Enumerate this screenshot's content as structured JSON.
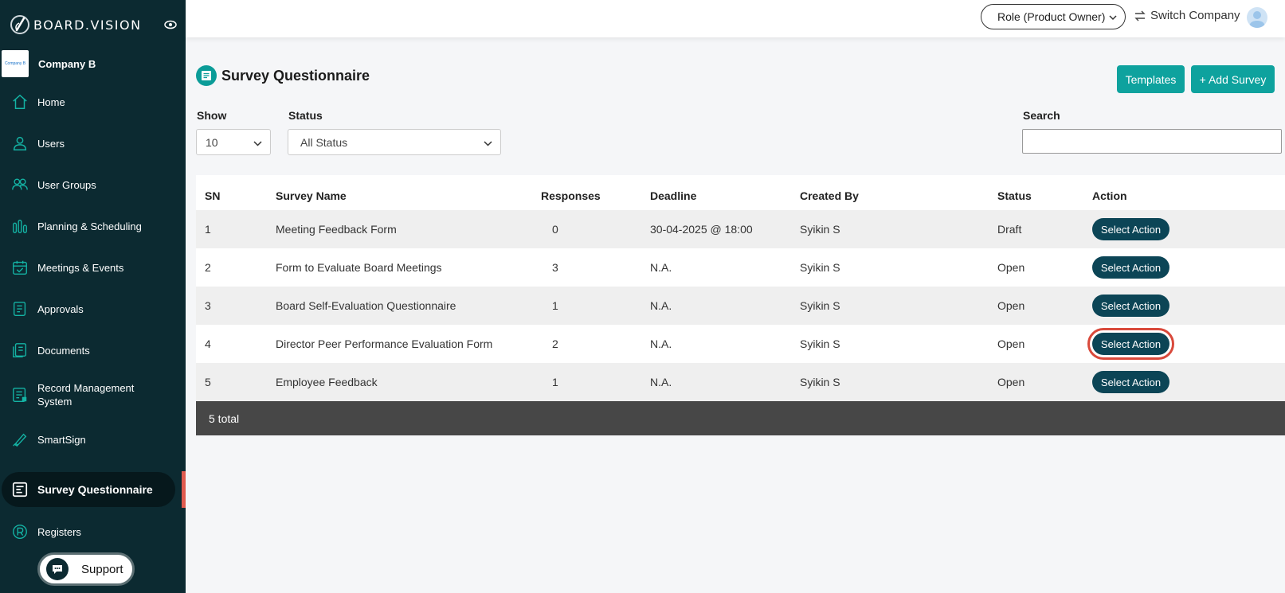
{
  "brand": {
    "name": "BOARD.VISION"
  },
  "company": {
    "name": "Company B",
    "logo_text": "Company B"
  },
  "sidebar": {
    "items": [
      {
        "label": "Home",
        "icon": "home-icon"
      },
      {
        "label": "Users",
        "icon": "user-icon"
      },
      {
        "label": "User Groups",
        "icon": "users-icon"
      },
      {
        "label": "Planning & Scheduling",
        "icon": "bar-chart-icon"
      },
      {
        "label": "Meetings & Events",
        "icon": "calendar-icon"
      },
      {
        "label": "Approvals",
        "icon": "approval-icon"
      },
      {
        "label": "Documents",
        "icon": "documents-icon"
      },
      {
        "label": "Record Management System",
        "icon": "record-icon"
      },
      {
        "label": "SmartSign",
        "icon": "pen-icon"
      },
      {
        "label": "Survey Questionnaire",
        "icon": "survey-icon",
        "active": true
      },
      {
        "label": "Registers",
        "icon": "registered-icon"
      }
    ],
    "support_label": "Support"
  },
  "topbar": {
    "role_label": "Role (Product Owner)",
    "switch_company_label": "Switch Company"
  },
  "page": {
    "title": "Survey Questionnaire",
    "templates_label": "Templates",
    "add_survey_label": "+ Add Survey"
  },
  "filters": {
    "show_label": "Show",
    "show_value": "10",
    "status_label": "Status",
    "status_value": "All Status",
    "search_label": "Search",
    "search_placeholder": ""
  },
  "table": {
    "headers": [
      "SN",
      "Survey Name",
      "Responses",
      "Deadline",
      "Created By",
      "Status",
      "Action"
    ],
    "rows": [
      {
        "sn": "1",
        "name": "Meeting Feedback Form",
        "responses": "0",
        "deadline": "30-04-2025 @ 18:00",
        "created_by": "Syikin S",
        "status": "Draft",
        "action": "Select Action"
      },
      {
        "sn": "2",
        "name": "Form to Evaluate Board Meetings",
        "responses": "3",
        "deadline": "N.A.",
        "created_by": "Syikin S",
        "status": "Open",
        "action": "Select Action"
      },
      {
        "sn": "3",
        "name": "Board Self-Evaluation Questionnaire",
        "responses": "1",
        "deadline": "N.A.",
        "created_by": "Syikin S",
        "status": "Open",
        "action": "Select Action"
      },
      {
        "sn": "4",
        "name": "Director Peer Performance Evaluation Form",
        "responses": "2",
        "deadline": "N.A.",
        "created_by": "Syikin S",
        "status": "Open",
        "action": "Select Action"
      },
      {
        "sn": "5",
        "name": "Employee Feedback",
        "responses": "1",
        "deadline": "N.A.",
        "created_by": "Syikin S",
        "status": "Open",
        "action": "Select Action"
      }
    ],
    "footer": "5 total"
  },
  "colors": {
    "sidebar_bg": "#0c2a31",
    "accent": "#0ea29e",
    "action_btn": "#0c4556",
    "highlight": "#d9493b"
  }
}
